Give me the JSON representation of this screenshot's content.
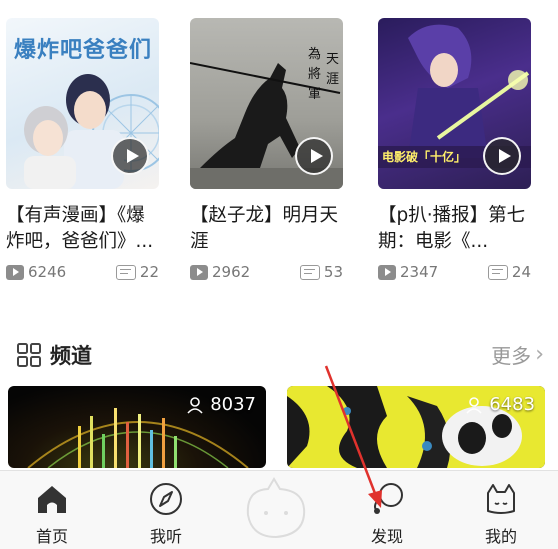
{
  "video_cards": [
    {
      "title": "【有声漫画】《爆炸吧，爸爸们》...",
      "views": "6246",
      "comments": "22",
      "thumb_text": "爆炸吧爸爸们"
    },
    {
      "title": "【赵子龙】明月天涯",
      "views": "2962",
      "comments": "53"
    },
    {
      "title": "【p扒·播报】第七期：电影《...",
      "views": "2347",
      "comments": "24",
      "thumb_text": "电影破「十亿」"
    }
  ],
  "channels_section": {
    "title": "频道",
    "more_label": "更多",
    "channels": [
      {
        "count": "8037"
      },
      {
        "count": "6483"
      }
    ]
  },
  "tabbar": {
    "items": [
      {
        "label": "首页",
        "icon": "home-icon"
      },
      {
        "label": "我听",
        "icon": "compass-icon"
      },
      {
        "label": "",
        "icon": "mascot-icon"
      },
      {
        "label": "发现",
        "icon": "discover-icon"
      },
      {
        "label": "我的",
        "icon": "profile-cat-icon"
      }
    ]
  },
  "colors": {
    "accent_red": "#e0322d",
    "text_dark": "#1a1a1a",
    "text_gray": "#777777"
  }
}
